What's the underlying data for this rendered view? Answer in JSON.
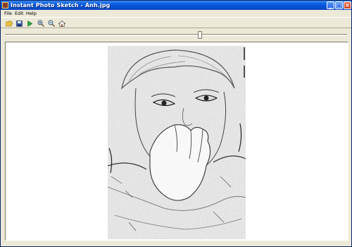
{
  "window": {
    "title": "Instant Photo Sketch - Anh.jpg"
  },
  "titlebar_buttons": {
    "minimize": "_",
    "maximize": "□",
    "close": "×"
  },
  "menu": [
    {
      "label": "File"
    },
    {
      "label": "Edit"
    },
    {
      "label": "Help"
    }
  ],
  "toolbar": [
    {
      "icon": "folder-open-icon"
    },
    {
      "icon": "save-icon"
    },
    {
      "icon": "play-icon"
    },
    {
      "icon": "zoom-in-icon"
    },
    {
      "icon": "zoom-out-icon"
    },
    {
      "icon": "home-icon"
    }
  ],
  "slider": {
    "value": 0.57
  },
  "colors": {
    "titlebar": "#0a5de0",
    "chrome": "#ece9d8",
    "canvas": "#ffffff"
  }
}
